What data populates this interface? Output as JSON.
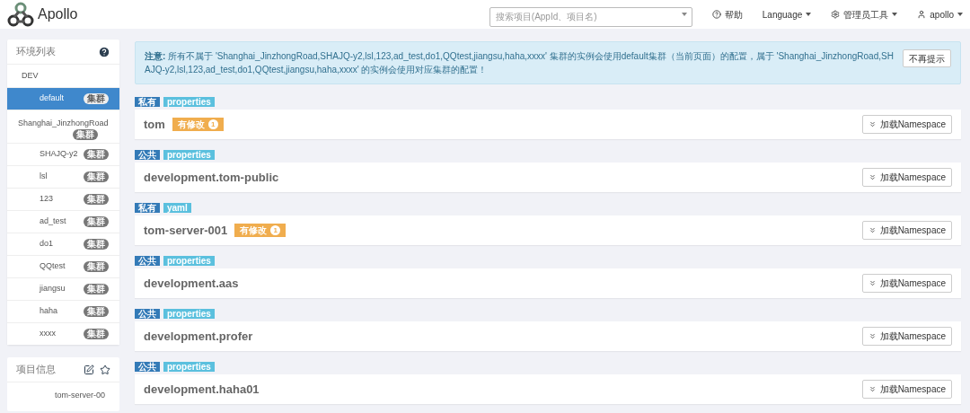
{
  "header": {
    "logo_text": "Apollo",
    "search": {
      "placeholder": "搜索项目(AppId、项目名)"
    },
    "nav": [
      {
        "kind": "help",
        "label": "帮助"
      },
      {
        "kind": "dropdown",
        "label": "Language"
      },
      {
        "kind": "admin",
        "label": "管理员工具"
      },
      {
        "kind": "user",
        "label": "apollo"
      }
    ]
  },
  "env_panel": {
    "title": "环境列表",
    "envs": [
      {
        "name": "DEV",
        "children": [
          {
            "name": "default",
            "badge": "集群",
            "selected": true,
            "kind": "normal"
          },
          {
            "name": "Shanghai_JinzhongRoad",
            "badge": "集群",
            "selected": false,
            "kind": "wrapped"
          },
          {
            "name": "SHAJQ-y2",
            "badge": "集群",
            "selected": false,
            "kind": "normal"
          },
          {
            "name": "lsl",
            "badge": "集群",
            "selected": false,
            "kind": "normal"
          },
          {
            "name": "123",
            "badge": "集群",
            "selected": false,
            "kind": "normal"
          },
          {
            "name": "ad_test",
            "badge": "集群",
            "selected": false,
            "kind": "normal"
          },
          {
            "name": "do1",
            "badge": "集群",
            "selected": false,
            "kind": "normal"
          },
          {
            "name": "QQtest",
            "badge": "集群",
            "selected": false,
            "kind": "normal"
          },
          {
            "name": "jiangsu",
            "badge": "集群",
            "selected": false,
            "kind": "normal"
          },
          {
            "name": "haha",
            "badge": "集群",
            "selected": false,
            "kind": "normal"
          },
          {
            "name": "xxxx",
            "badge": "集群",
            "selected": false,
            "kind": "normal"
          }
        ]
      }
    ]
  },
  "project_panel": {
    "title": "项目信息",
    "app_id": "tom-server-00"
  },
  "notice": {
    "text": "**注意:** 所有不属于 'Shanghai_JinzhongRoad,SHAJQ-y2,lsl,123,ad_test,do1,QQtest,jiangsu,haha,xxxx' 集群的实例会使用default集群（当前页面）的配置，属于 'Shanghai_JinzhongRoad,SHAJQ-y2,lsl,123,ad_test,do1,QQtest,jiangsu,haha,xxxx' 的实例会使用对应集群的配置！",
    "dismiss": "不再提示"
  },
  "namespaces": [
    {
      "scope": "私有",
      "format": "properties",
      "name": "tom",
      "modified": "有修改",
      "count": "1",
      "button": "加载Namespace"
    },
    {
      "scope": "公共",
      "format": "properties",
      "name": "development.tom-public",
      "button": "加载Namespace"
    },
    {
      "scope": "私有",
      "format": "yaml",
      "name": "tom-server-001",
      "modified": "有修改",
      "count": "1",
      "button": "加载Namespace"
    },
    {
      "scope": "公共",
      "format": "properties",
      "name": "development.aas",
      "button": "加载Namespace"
    },
    {
      "scope": "公共",
      "format": "properties",
      "name": "development.profer",
      "button": "加载Namespace"
    },
    {
      "scope": "公共",
      "format": "properties",
      "name": "development.haha01",
      "button": "加载Namespace"
    }
  ]
}
